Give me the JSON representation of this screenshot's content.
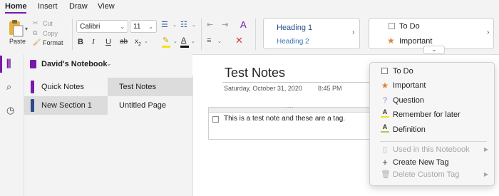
{
  "ribbon_tabs": [
    "Home",
    "Insert",
    "Draw",
    "View"
  ],
  "clipboard": {
    "paste": "Paste",
    "cut": "Cut",
    "copy": "Copy",
    "format": "Format"
  },
  "font": {
    "family": "Calibri",
    "size": "11"
  },
  "styles": {
    "heading1": "Heading 1",
    "heading2": "Heading 2"
  },
  "tags_gallery": {
    "todo": "To Do",
    "important": "Important"
  },
  "notebook": {
    "name": "David's Notebook",
    "sections": [
      {
        "label": "Quick Notes",
        "color": "#7719aa"
      },
      {
        "label": "New Section 1",
        "color": "#2c4a8c"
      }
    ],
    "pages": [
      "Test Notes",
      "Untitled Page"
    ]
  },
  "page": {
    "title": "Test Notes",
    "date": "Saturday, October 31, 2020",
    "time": "8:45 PM",
    "note_text": "This is a test note and these are a tag."
  },
  "tag_menu": {
    "items": [
      {
        "label": "To Do",
        "icon": "checkbox-icon"
      },
      {
        "label": "Important",
        "icon": "star-icon"
      },
      {
        "label": "Question",
        "icon": "question-icon"
      },
      {
        "label": "Remember for later",
        "icon": "highlighter-icon"
      },
      {
        "label": "Definition",
        "icon": "highlighter-icon"
      }
    ],
    "used_in_notebook": "Used in this Notebook",
    "create_new_tag": "Create New Tag",
    "delete_custom_tag": "Delete Custom Tag"
  },
  "colors": {
    "accent": "#7719aa",
    "star": "#e0863a",
    "highlight": "#f2e21a"
  }
}
